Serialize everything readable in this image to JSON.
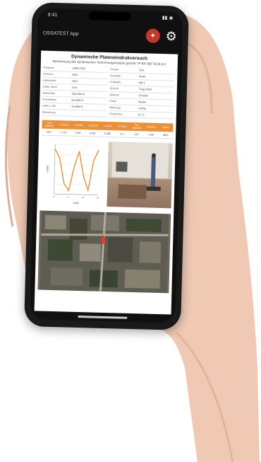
{
  "app": {
    "title": "OSSATEST App",
    "status_time": "9:41",
    "logo_icon": "logo-icon",
    "settings_icon": "gear-icon"
  },
  "report": {
    "title": "Dynamische Plateneindrukversuch",
    "subtitle": "Bestimmung des dynamischen Verformungsmoduls gemäß TP BF-StB Teil B 8.3",
    "info_left": [
      {
        "k": "Prüfgerät",
        "v": "ZORN ZFG"
      },
      {
        "k": "Seriennr.",
        "v": "3020"
      },
      {
        "k": "Kalibrierdat.",
        "v": "2024"
      },
      {
        "k": "Kalibr. durch",
        "v": "Zorn"
      },
      {
        "k": "Datum/Zeit",
        "v": "2024-06-12"
      },
      {
        "k": "Koordinaten",
        "v": "52.5200 N"
      },
      {
        "k": "Höhe ü. NN",
        "v": "13.4050 E"
      },
      {
        "k": "Bemerkung",
        "v": ""
      }
    ],
    "info_right": [
      {
        "k": "Projekt",
        "v": "Test"
      },
      {
        "k": "Baustelle",
        "v": "Berlin"
      },
      {
        "k": "Prüfstelle",
        "v": "MP 1"
      },
      {
        "k": "Schicht",
        "v": "Tragschicht"
      },
      {
        "k": "Material",
        "v": "Schotter"
      },
      {
        "k": "Prüfer",
        "v": "Muster"
      },
      {
        "k": "Witterung",
        "v": "sonnig"
      },
      {
        "k": "Temperatur",
        "v": "21 °C"
      }
    ],
    "metric_headers": [
      "Evd [MN/m²]",
      "s1 [mm]",
      "s2 [mm]",
      "s3 [mm]",
      "s [mm]",
      "s/v [ms]",
      "Ev2 [MN/m²]",
      "Ev2/Ev1",
      "Dichte"
    ],
    "metric_values": [
      "49.2",
      "0.458",
      "0.46",
      "0.457",
      "0.458",
      "2.1",
      "147",
      "2.09",
      "98%"
    ]
  },
  "chart_data": {
    "type": "line",
    "title": "",
    "xlabel": "t [ms]",
    "ylabel": "s [mm]",
    "x": [
      0,
      2,
      4,
      6,
      8,
      10,
      12,
      14,
      16,
      18
    ],
    "series": [
      {
        "name": "",
        "values": [
          0.0,
          -0.1,
          -0.38,
          -0.46,
          -0.2,
          -0.02,
          -0.3,
          -0.45,
          -0.12,
          0.0
        ]
      }
    ],
    "ylim": [
      -0.5,
      0.05
    ],
    "color": "#e8913a"
  }
}
